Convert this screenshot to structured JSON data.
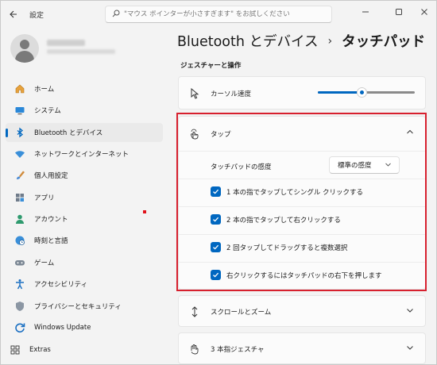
{
  "window": {
    "app_title": "設定",
    "search_placeholder": "\"マウス ポインターが小さすぎます\" をお試しください"
  },
  "profile": {
    "name": "",
    "email": ""
  },
  "sidebar": {
    "items": [
      {
        "label": "ホーム",
        "icon": "home-icon"
      },
      {
        "label": "システム",
        "icon": "system-icon"
      },
      {
        "label": "Bluetooth とデバイス",
        "icon": "bluetooth-icon",
        "active": true
      },
      {
        "label": "ネットワークとインターネット",
        "icon": "wifi-icon"
      },
      {
        "label": "個人用設定",
        "icon": "brush-icon"
      },
      {
        "label": "アプリ",
        "icon": "apps-icon"
      },
      {
        "label": "アカウント",
        "icon": "account-icon"
      },
      {
        "label": "時刻と言語",
        "icon": "globe-clock-icon"
      },
      {
        "label": "ゲーム",
        "icon": "gamepad-icon"
      },
      {
        "label": "アクセシビリティ",
        "icon": "accessibility-icon"
      },
      {
        "label": "プライバシーとセキュリティ",
        "icon": "shield-icon"
      },
      {
        "label": "Windows Update",
        "icon": "update-icon"
      }
    ],
    "extras_label": "Extras"
  },
  "header": {
    "breadcrumb_parent": "Bluetooth とデバイス",
    "separator": "›",
    "current": "タッチパッド"
  },
  "section": {
    "label": "ジェスチャーと操作"
  },
  "cursor_speed": {
    "label": "カーソル速度",
    "value_fraction": 0.45
  },
  "tap": {
    "title": "タップ",
    "sensitivity_label": "タッチパッドの感度",
    "sensitivity_value": "標準の感度",
    "options": [
      {
        "label": "1 本の指でタップしてシングル クリックする",
        "checked": true
      },
      {
        "label": "2 本の指でタップして右クリックする",
        "checked": true
      },
      {
        "label": "2 回タップしてドラッグすると複数選択",
        "checked": true
      },
      {
        "label": "右クリックするにはタッチパッドの右下を押します",
        "checked": true
      }
    ]
  },
  "scroll_zoom": {
    "title": "スクロールとズーム"
  },
  "three_finger": {
    "title": "3 本指ジェスチャ"
  },
  "colors": {
    "accent": "#0067c0",
    "highlight": "#d7202e"
  }
}
